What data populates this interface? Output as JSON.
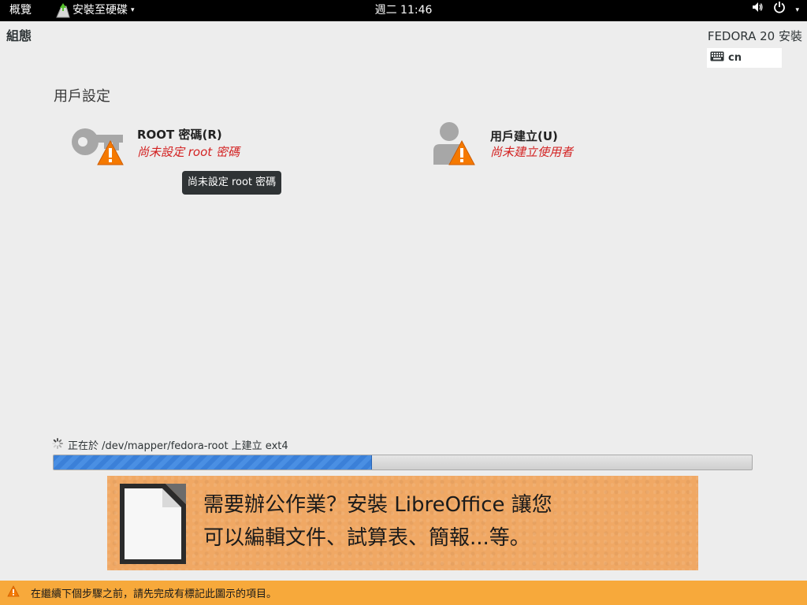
{
  "topbar": {
    "activities": "概覽",
    "app_name": "安裝至硬碟",
    "caret": "▾",
    "clock": "週二 11:46",
    "volume_icon": "volume-icon",
    "power_icon": "power-icon"
  },
  "header": {
    "section_title": "組態",
    "product_title": "FEDORA 20 安裝",
    "keyboard_layout": "cn"
  },
  "category": {
    "label": "用戶設定"
  },
  "spokes": {
    "root": {
      "title": "ROOT 密碼(R)",
      "status": "尚未設定 root 密碼",
      "icon": "key-icon"
    },
    "user": {
      "title": "用戶建立(U)",
      "status": "尚未建立使用者",
      "icon": "user-icon"
    }
  },
  "tooltip": {
    "text": "尚未設定 root 密碼"
  },
  "progress": {
    "text": "正在於 /dev/mapper/fedora-root 上建立 ext4",
    "fraction": 0.455
  },
  "banner": {
    "line1": "需要辦公作業？安裝 LibreOffice 讓您",
    "line2": "可以編輯文件、試算表、簡報...等。"
  },
  "warning_bar": {
    "text": "在繼續下個步驟之前，請先完成有標記此圖示的項目。"
  },
  "colors": {
    "warning_orange": "#f7a93b",
    "status_red": "#d32222",
    "progress_blue": "#3b80d8",
    "banner_orange": "#f0a864"
  }
}
